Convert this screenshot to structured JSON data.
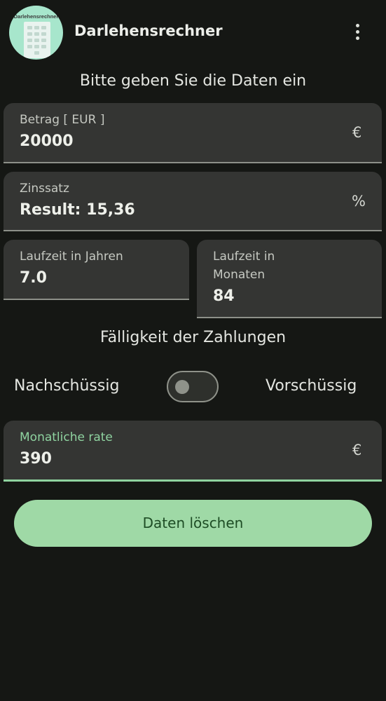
{
  "app": {
    "title": "Darlehensrechner",
    "logo_text": "Darlehensrechner"
  },
  "form": {
    "subtitle": "Bitte geben Sie die Daten ein",
    "amount": {
      "label": "Betrag [ EUR ]",
      "value": "20000",
      "suffix": "€"
    },
    "interest": {
      "label": "Zinssatz",
      "value": "Result: 15,36",
      "suffix": "%"
    },
    "years": {
      "label": "Laufzeit in Jahren",
      "value": "7.0"
    },
    "months": {
      "label_line1": "Laufzeit in",
      "label_line2": "Monaten",
      "value": "84"
    }
  },
  "payment_timing": {
    "title": "Fälligkeit der Zahlungen",
    "left_option": "Nachschüssig",
    "right_option": "Vorschüssig",
    "switch_on": false
  },
  "result": {
    "label": "Monatliche rate",
    "value": "390",
    "suffix": "€"
  },
  "actions": {
    "clear_label": "Daten löschen"
  },
  "colors": {
    "background": "#151714",
    "field_bg": "#343533",
    "accent_green": "#9fd9a6",
    "result_label": "#8fd3a0"
  },
  "icons": {
    "menu": "more-vert-icon"
  }
}
